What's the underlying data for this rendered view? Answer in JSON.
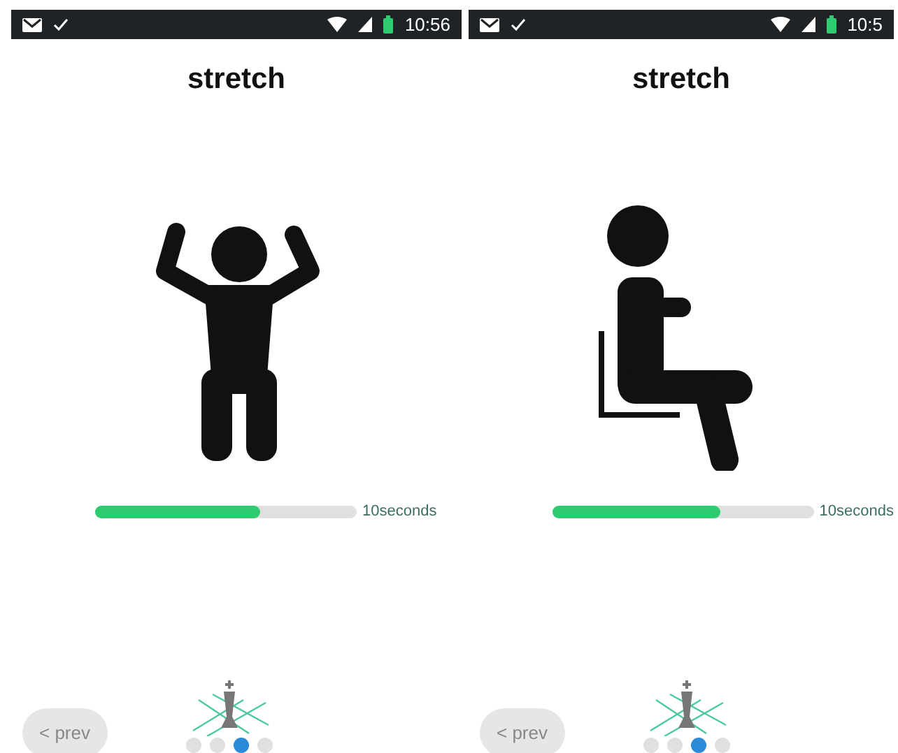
{
  "screens": [
    {
      "status_bar": {
        "time": "10:56"
      },
      "title": "stretch",
      "figure": {
        "kind": "arms-up"
      },
      "progress": {
        "level": 0.63,
        "label": "10seconds"
      },
      "prev_button": "< prev",
      "pages": [
        {
          "selected": false
        },
        {
          "selected": false
        },
        {
          "selected": true
        },
        {
          "selected": false
        }
      ]
    },
    {
      "status_bar": {
        "time": "10:5"
      },
      "title": "stretch",
      "figure": {
        "kind": "seated"
      },
      "progress": {
        "level": 0.64,
        "label": "10seconds"
      },
      "prev_button": "< prev",
      "pages": [
        {
          "selected": false
        },
        {
          "selected": false
        },
        {
          "selected": true
        },
        {
          "selected": false
        }
      ]
    }
  ]
}
